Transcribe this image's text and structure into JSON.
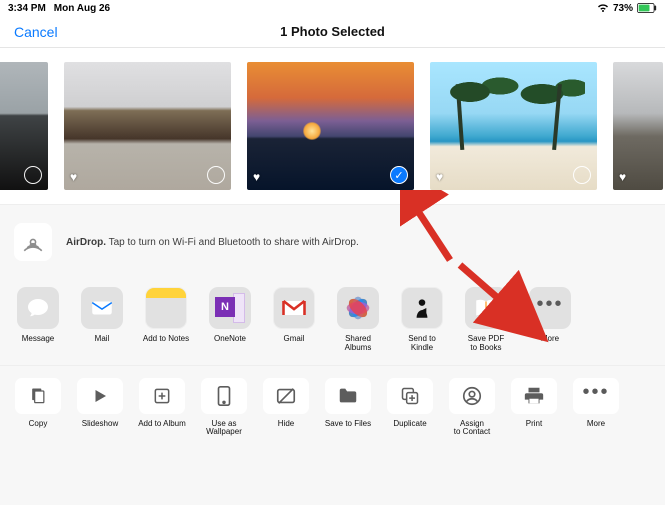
{
  "status": {
    "time": "3:34 PM",
    "date": "Mon Aug 26",
    "battery_pct": "73%"
  },
  "navbar": {
    "cancel": "Cancel",
    "title": "1 Photo Selected"
  },
  "photos": [
    {
      "favorite": false,
      "selected_open": true,
      "selected_check": false
    },
    {
      "favorite": true,
      "selected_open": true,
      "selected_check": false
    },
    {
      "favorite": true,
      "selected_open": false,
      "selected_check": true
    },
    {
      "favorite": true,
      "selected_open": true,
      "selected_check": false
    },
    {
      "favorite": true,
      "selected_open": false,
      "selected_check": false
    }
  ],
  "airdrop": {
    "bold": "AirDrop.",
    "text": " Tap to turn on Wi-Fi and Bluetooth to share with AirDrop."
  },
  "apps": {
    "message": "Message",
    "mail": "Mail",
    "add_to_notes": "Add to Notes",
    "onenote": "OneNote",
    "gmail": "Gmail",
    "shared_albums": "Shared Albums",
    "send_to_kindle": "Send to Kindle",
    "save_pdf_books": "Save PDF\nto Books",
    "more": "More"
  },
  "actions": {
    "copy": "Copy",
    "slideshow": "Slideshow",
    "add_to_album": "Add to Album",
    "use_as_wallpaper": "Use as\nWallpaper",
    "hide": "Hide",
    "save_to_files": "Save to Files",
    "duplicate": "Duplicate",
    "assign_to_contact": "Assign\nto Contact",
    "print": "Print",
    "more": "More"
  },
  "onenote_letter": "N"
}
